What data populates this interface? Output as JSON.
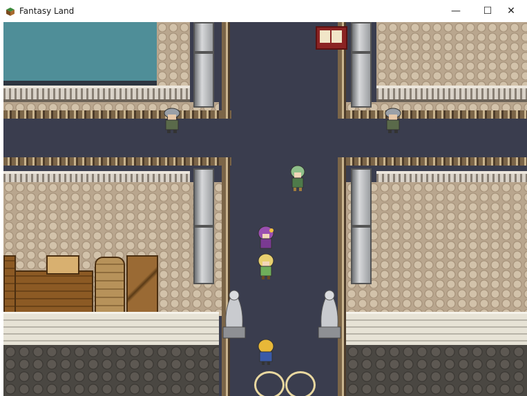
{
  "window": {
    "title": "Fantasy Land",
    "controls": {
      "minimize": "—",
      "maximize": "☐",
      "close": "✕"
    }
  },
  "colors": {
    "road": "#3a3d4e",
    "water": "#4f8e98",
    "cobblestone": "#b9a68e",
    "wall": "#e7e3d6"
  },
  "game": {
    "scene": "town-crossroads",
    "characters": [
      "guard-left",
      "guard-right",
      "green-haired-npc",
      "purple-haired-npc",
      "blonde-party-member",
      "blonde-player"
    ]
  }
}
